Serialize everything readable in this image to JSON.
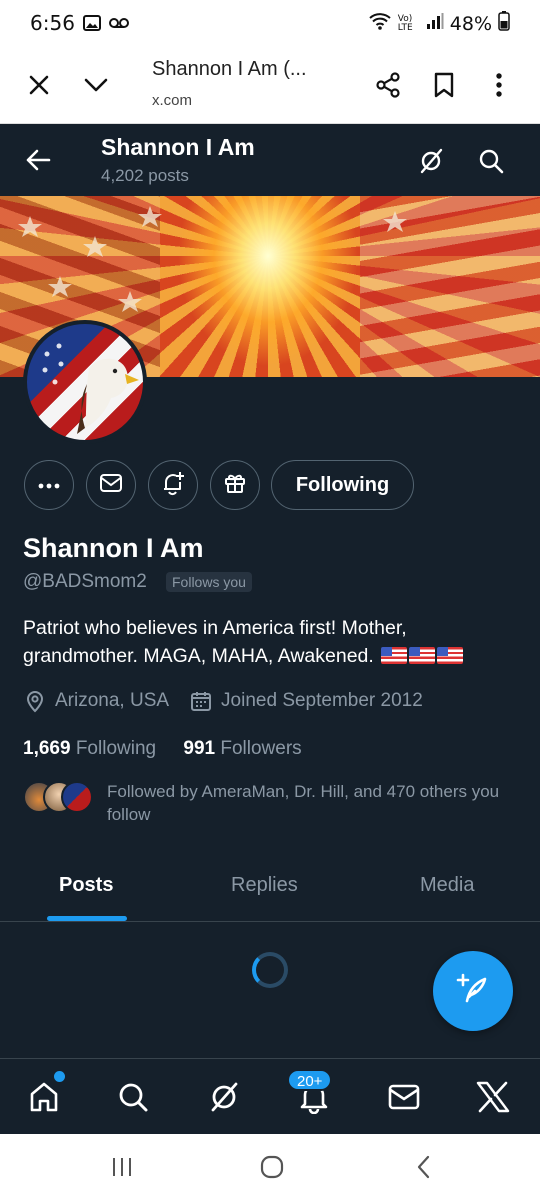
{
  "status_bar": {
    "time": "6:56",
    "battery": "48%",
    "network": "Vo) LTE",
    "icons": [
      "image-icon",
      "voicemail-icon",
      "wifi-icon",
      "signal-icon",
      "battery-icon"
    ]
  },
  "browser": {
    "title": "Shannon I Am (...",
    "url": "x.com",
    "icons": [
      "close-icon",
      "chevron-down-icon",
      "share-icon",
      "bookmark-icon",
      "more-vertical-icon"
    ]
  },
  "header": {
    "name": "Shannon I Am",
    "posts_count": "4,202 posts",
    "icons": [
      "back-arrow-icon",
      "grok-icon",
      "search-icon"
    ]
  },
  "profile": {
    "name": "Shannon I Am",
    "handle": "@BADSmom2",
    "follows_you": "Follows you",
    "bio": "Patriot who believes in America first! Mother, grandmother. MAGA, MAHA, Awakened.",
    "location": "Arizona, USA",
    "joined": "Joined September 2012",
    "following_count": "1,669",
    "following_label": "Following",
    "followers_count": "991",
    "followers_label": "Followers",
    "followed_by": "Followed by AmeraMan, Dr. Hill, and 470 others you follow"
  },
  "actions": {
    "following_button": "Following",
    "icons": [
      "more-horizontal-icon",
      "message-icon",
      "notification-plus-icon",
      "gift-icon"
    ]
  },
  "tabs": [
    {
      "label": "Posts",
      "active": true
    },
    {
      "label": "Replies",
      "active": false
    },
    {
      "label": "Media",
      "active": false
    }
  ],
  "bottom_nav": {
    "notification_badge": "20+",
    "icons": [
      "home-icon",
      "search-icon",
      "grok-icon",
      "notifications-icon",
      "messages-icon",
      "x-logo-icon"
    ]
  },
  "colors": {
    "background": "#15202b",
    "accent": "#1d9bf0",
    "muted_text": "#8b98a5"
  }
}
